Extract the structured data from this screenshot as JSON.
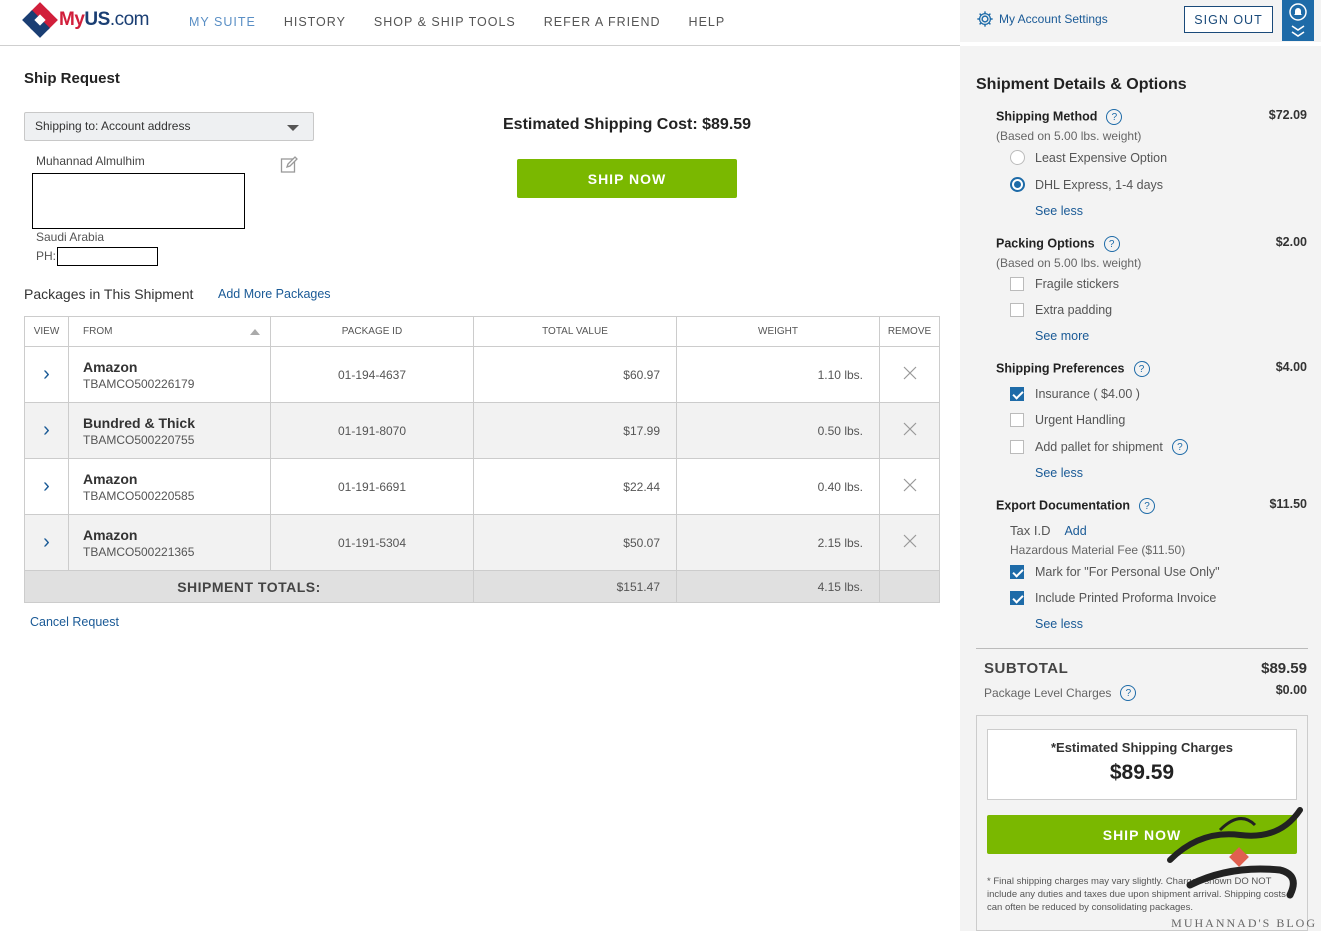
{
  "brand": {
    "my": "My",
    "us": "US",
    "com": ".com"
  },
  "nav": [
    {
      "label": "MY SUITE"
    },
    {
      "label": "HISTORY"
    },
    {
      "label": "SHOP & SHIP TOOLS"
    },
    {
      "label": "REFER A FRIEND"
    },
    {
      "label": "HELP"
    }
  ],
  "header_right": {
    "account_settings": "My Account Settings",
    "sign_out": "SIGN OUT"
  },
  "page_title": "Ship Request",
  "shipping_to": "Shipping to: Account address",
  "address": {
    "name": "Muhannad Almulhim",
    "country": "Saudi Arabia",
    "phone_label": "PH:"
  },
  "estimated_cost": "Estimated Shipping Cost: $89.59",
  "ship_now": "SHIP NOW",
  "packages": {
    "label": "Packages in This Shipment",
    "add_more": "Add More Packages",
    "columns": [
      "VIEW",
      "FROM",
      "PACKAGE ID",
      "TOTAL VALUE",
      "WEIGHT",
      "REMOVE"
    ],
    "rows": [
      {
        "from": "Amazon",
        "ref": "TBAMCO500226179",
        "package_id": "01-194-4637",
        "value": "$60.97",
        "weight": "1.10 lbs."
      },
      {
        "from": "Bundred & Thick",
        "ref": "TBAMCO500220755",
        "package_id": "01-191-8070",
        "value": "$17.99",
        "weight": "0.50 lbs."
      },
      {
        "from": "Amazon",
        "ref": "TBAMCO500220585",
        "package_id": "01-191-6691",
        "value": "$22.44",
        "weight": "0.40 lbs."
      },
      {
        "from": "Amazon",
        "ref": "TBAMCO500221365",
        "package_id": "01-191-5304",
        "value": "$50.07",
        "weight": "2.15 lbs."
      }
    ],
    "totals_label": "SHIPMENT TOTALS:",
    "total_value": "$151.47",
    "total_weight": "4.15 lbs."
  },
  "cancel": "Cancel Request",
  "details": {
    "title": "Shipment Details & Options",
    "shipping_method": {
      "label": "Shipping Method",
      "sub": "(Based on 5.00 lbs. weight)",
      "price": "$72.09",
      "options": [
        "Least Expensive Option",
        "DHL Express, 1-4 days"
      ],
      "link": "See less"
    },
    "packing": {
      "label": "Packing Options",
      "sub": "(Based on 5.00 lbs. weight)",
      "price": "$2.00",
      "options": [
        "Fragile stickers",
        "Extra padding"
      ],
      "link": "See more"
    },
    "preferences": {
      "label": "Shipping Preferences",
      "price": "$4.00",
      "options": [
        "Insurance ( $4.00 )",
        "Urgent Handling",
        "Add pallet for shipment"
      ],
      "link": "See less"
    },
    "export": {
      "label": "Export Documentation",
      "price": "$11.50",
      "tax_id": "Tax I.D",
      "tax_add": "Add",
      "hazmat": "Hazardous Material Fee ($11.50)",
      "options": [
        "Mark for \"For Personal Use Only\"",
        "Include Printed Proforma Invoice"
      ],
      "link": "See less"
    },
    "subtotal_label": "SUBTOTAL",
    "subtotal_value": "$89.59",
    "package_charges_label": "Package Level Charges",
    "package_charges_value": "$0.00",
    "est_label": "*Estimated Shipping Charges",
    "est_value": "$89.59",
    "ship_now": "SHIP NOW",
    "disclaimer": "* Final shipping charges may vary slightly. Charges shown DO NOT include any duties and taxes due upon shipment arrival. Shipping costs can often be reduced by consolidating packages."
  },
  "watermark": "MUHANNAD'S BLOG",
  "colors": {
    "accent_green": "#7ab800",
    "link_blue": "#1a5a96",
    "brand_red": "#d11f3b",
    "brand_navy": "#1a3e73"
  }
}
